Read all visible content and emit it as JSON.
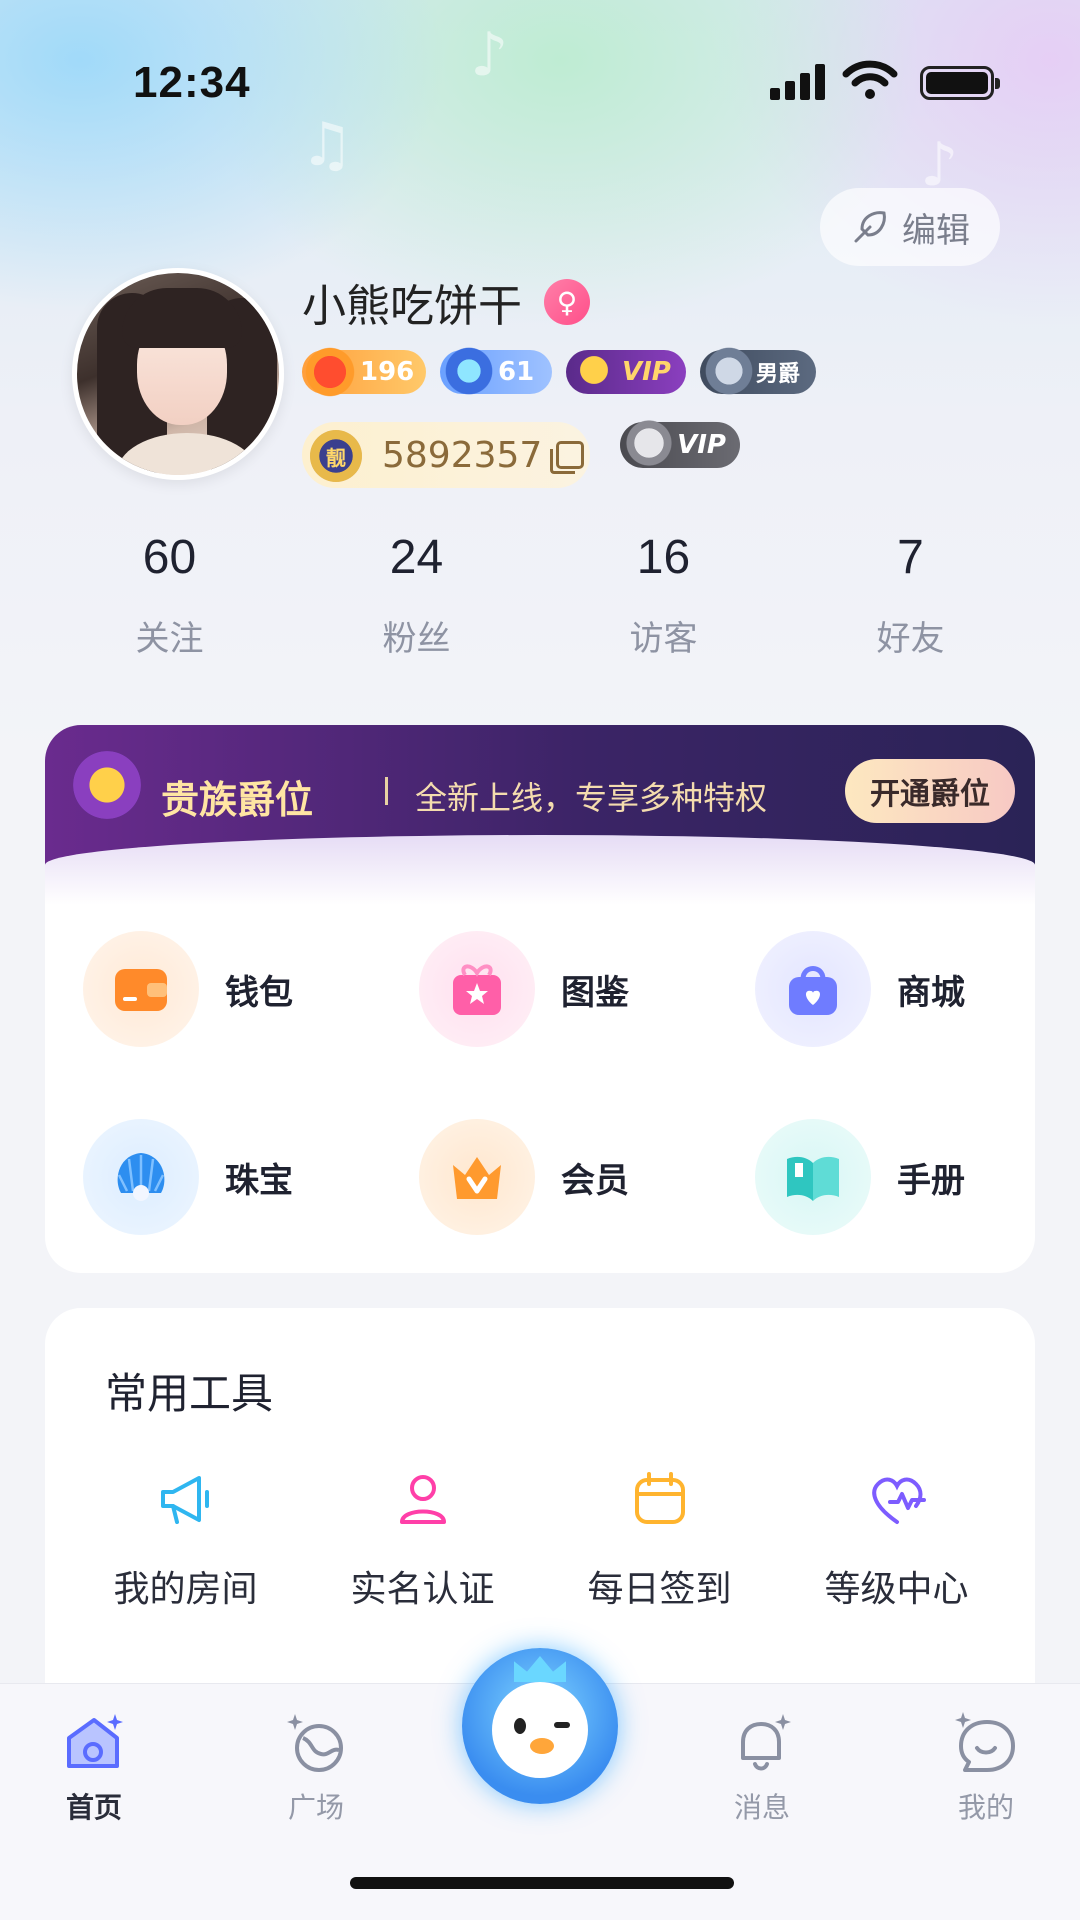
{
  "status_bar": {
    "time": "12:34"
  },
  "profile": {
    "edit_label": "编辑",
    "username": "小熊吃饼干",
    "gender_symbol": "♀",
    "badges": [
      {
        "name": "level",
        "value": "196"
      },
      {
        "name": "diamond",
        "value": "61"
      },
      {
        "name": "vip",
        "value": "VIP"
      },
      {
        "name": "baron",
        "value": "男爵"
      }
    ],
    "id_medal": "靓",
    "user_id": "5892357",
    "vip_silver": "VIP"
  },
  "stats": [
    {
      "value": "60",
      "label": "关注"
    },
    {
      "value": "24",
      "label": "粉丝"
    },
    {
      "value": "16",
      "label": "访客"
    },
    {
      "value": "7",
      "label": "好友"
    }
  ],
  "noble": {
    "title": "贵族爵位",
    "subtitle": "全新上线，专享多种特权",
    "button": "开通爵位"
  },
  "features": [
    {
      "label": "钱包",
      "icon": "wallet-icon",
      "color": "#ff8a2a"
    },
    {
      "label": "图鉴",
      "icon": "gift-star-icon",
      "color": "#ff5fa8"
    },
    {
      "label": "商城",
      "icon": "shopping-bag-icon",
      "color": "#6f7cff"
    },
    {
      "label": "珠宝",
      "icon": "shell-pearl-icon",
      "color": "#2d8ef0"
    },
    {
      "label": "会员",
      "icon": "crown-icon",
      "color": "#ff9a2e"
    },
    {
      "label": "手册",
      "icon": "book-icon",
      "color": "#2fc6c0"
    }
  ],
  "tools": {
    "title": "常用工具",
    "items": [
      {
        "label": "我的房间",
        "icon": "megaphone-icon",
        "color": "#2fb6f0"
      },
      {
        "label": "实名认证",
        "icon": "person-icon",
        "color": "#ff3fa8"
      },
      {
        "label": "每日签到",
        "icon": "calendar-icon",
        "color": "#ffb42e"
      },
      {
        "label": "等级中心",
        "icon": "heart-pulse-icon",
        "color": "#7d5cff"
      }
    ]
  },
  "nav": [
    {
      "label": "首页",
      "icon": "home-icon",
      "active": true
    },
    {
      "label": "广场",
      "icon": "planet-icon",
      "active": false
    },
    {
      "label": "消息",
      "icon": "bell-icon",
      "active": false
    },
    {
      "label": "我的",
      "icon": "smile-chat-icon",
      "active": false
    }
  ],
  "colors": {
    "accent_blue": "#3a8df0",
    "noble_gold": "#ffe5a3",
    "noble_purple": "#3b2466"
  }
}
